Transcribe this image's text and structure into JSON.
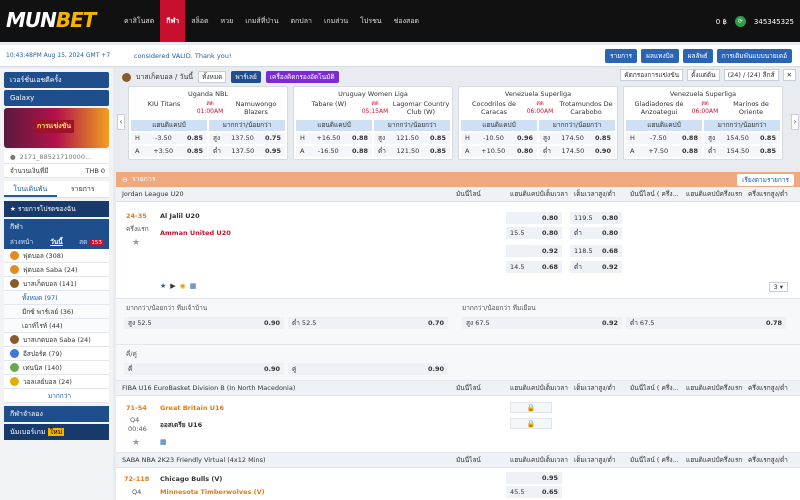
{
  "brand": {
    "logo_a": "MUN",
    "logo_b": "BET"
  },
  "nav": [
    "คาสิโนสด",
    "กีฬา",
    "สล็อต",
    "หวย",
    "เกมส์ที่ป่าน",
    "ตกปลา",
    "เกมส่วน",
    "โปรชน",
    "ช่องสอด"
  ],
  "nav_active": 1,
  "account": {
    "balance": "0 ฿",
    "user": "345345325"
  },
  "ticker": {
    "time": "10:43:48PM Aug 15, 2024 GMT +7",
    "message": "considered VALID. Thank you!",
    "buttons": [
      "รายการ",
      "ผลแทงบิล",
      "ผลลัพธ์",
      "การเดิมพันแบบนายเดอ์"
    ]
  },
  "sidebar": {
    "banner1": "เวอร์ชั่นเอชดีครั้ง",
    "banner2": "Galaxy",
    "promo": "การแข่งขัน",
    "account_id": "2171_88521710000...",
    "balance_label": "จำนวนเงินที่มี",
    "balance": "THB 0",
    "tabs": [
      "โบนเดินพัน",
      "รายการ"
    ],
    "favorites": "รายการโปรดของฉัน",
    "sport_header": "กีฬา",
    "subtabs": [
      "ล่วงหน้า",
      "วันนี้",
      "สด"
    ],
    "live_count": "153",
    "items": [
      {
        "label": "ฟุตบอล (308)",
        "icon": "football-icon"
      },
      {
        "label": "ฟุตบอล Saba (24)",
        "icon": "football-icon"
      },
      {
        "label": "บาสเก็ตบอล (141)",
        "icon": "basketball-icon"
      }
    ],
    "subitems": [
      "ทั้งหมด (97)",
      "มีกซ์ พาร์เลย์ (36)",
      "เอาท์ไรท์ (44)"
    ],
    "items2": [
      {
        "label": "บาสเกตบอล Saba (24)",
        "icon": "basketball-icon"
      },
      {
        "label": "อีสปอร์ต (79)",
        "icon": "esport-icon"
      },
      {
        "label": "เทนนิส (140)",
        "icon": "tennis-icon"
      },
      {
        "label": "วอลเลย์บอล (24)",
        "icon": "volleyball-icon"
      }
    ],
    "more": "มากกว่า",
    "virtual": "กีฬาจำลอง",
    "number": "นัมเบอร์เกม",
    "new_badge": "ใหม่"
  },
  "main": {
    "title": "บาสเก็ตบอล / วันนี้",
    "filter": "ทั้งหมด",
    "parlay": "พาร์เลย์",
    "combo": "เครื่องคิดกรองอัตโนมัติ",
    "sort": "คัดกรองการแข่งขัน",
    "view": "ตั้งแต่ต้น",
    "count": "(24) / (24) ลีกส์"
  },
  "cards": [
    {
      "league": "Uganda NBL",
      "home": "KIU Titans",
      "away": "Namuwongo Blazers",
      "live": "สด",
      "time": "01:00AM",
      "h_hcp": "-3.50",
      "h_odds": "0.85",
      "a_hcp": "+3.50",
      "a_odds": "0.85",
      "ou_o": "137.50",
      "ou_o_odds": "0.75",
      "ou_u": "137.50",
      "ou_u_odds": "0.95"
    },
    {
      "league": "Uruguay Women Liga",
      "home": "Tabare (W)",
      "away": "Lagomar Country Club (W)",
      "live": "สด",
      "time": "05:15AM",
      "h_hcp": "+16.50",
      "h_odds": "0.88",
      "a_hcp": "-16.50",
      "a_odds": "0.88",
      "ou_o": "121.50",
      "ou_o_odds": "0.85",
      "ou_u": "121.50",
      "ou_u_odds": "0.85"
    },
    {
      "league": "Venezuela Superliga",
      "home": "Cocodrilos de Caracas",
      "away": "Trotamundos De Carabobo",
      "live": "สด",
      "time": "06:00AM",
      "h_hcp": "-10.50",
      "h_odds": "0.96",
      "a_hcp": "+10.50",
      "a_odds": "0.80",
      "ou_o": "174.50",
      "ou_o_odds": "0.85",
      "ou_u": "174.50",
      "ou_u_odds": "0.90"
    },
    {
      "league": "Venezuela Superliga",
      "home": "Gladiadores de Anzoategui",
      "away": "Marinos de Oriente",
      "live": "สด",
      "time": "06:00AM",
      "h_hcp": "-7.50",
      "h_odds": "0.88",
      "a_hcp": "+7.50",
      "a_odds": "0.88",
      "ou_o": "154.50",
      "ou_o_odds": "0.85",
      "ou_u": "154.50",
      "ou_u_odds": "0.85"
    }
  ],
  "card_labels": {
    "hcp": "แฮนดิแคปป์",
    "ou": "มากกว่า/น้อยกว่า",
    "over": "สูง",
    "under": "ต่ำ",
    "h": "H",
    "a": "A"
  },
  "board": {
    "header": "รายการ",
    "sort_btn": "เรียงตามรายการ",
    "col_headers": [
      "มันนี่ไลน์",
      "แฮนดิแคปป์เต็มเวลา",
      "เต็มเวลาสูง/ต่ำ",
      "มันนี่ไลน์ ( ครึ่ง...",
      "แฮนดิแคปป์ครึ่งแรก",
      "ครึ่งแรกสูง/ต่ำ"
    ],
    "league1": "Jordan League U20",
    "score1": "24-35",
    "period1": "ครึ่งแรก",
    "team1a": "Al Jalil U20",
    "team1b": "Amman United U20",
    "r1": {
      "hcp_o": "0.80",
      "ou_line": "119.5",
      "ou_o": "0.80",
      "hcp_line": "15.5",
      "hcp_b": "0.80",
      "under": "ต่ำ",
      "ou_u": "0.80"
    },
    "r2": {
      "hcp_o": "0.92",
      "ou_line": "118.5",
      "ou_o": "0.68",
      "hcp_line": "14.5",
      "hcp_b": "0.68",
      "under": "ต่ำ",
      "ou_u": "0.92"
    },
    "pager": "3",
    "ou_home": "มากกว่า/น้อยกว่า ทีมเจ้าบ้าน",
    "ou_away": "มากกว่า/น้อยกว่า ทีมเยือน",
    "ou_home_rows": [
      {
        "l": "สูง 52.5",
        "v": "0.90"
      },
      {
        "l": "ต่ำ 52.5",
        "v": "0.70"
      }
    ],
    "ou_away_rows": [
      {
        "l": "สูง 67.5",
        "v": "0.92"
      },
      {
        "l": "ต่ำ 67.5",
        "v": "0.78"
      }
    ],
    "oddeven": "คี่/คู่",
    "odd": "คี่",
    "odd_v": "0.90",
    "even": "คู่",
    "even_v": "0.90",
    "league2": "FIBA U16 EuroBasket Division B (In North Macedonia)",
    "score2": "71-54",
    "period2": "Q4",
    "clock2": "00:46",
    "team2a": "Great Britain U16",
    "team2b": "ออสเตรีย U16",
    "league3": "SABA NBA 2K23 Friendly Virtual (4x12 Mins)",
    "score3": "72-118",
    "period3": "Q4",
    "team3a": "Chicago Bulls (V)",
    "team3b": "Minnesota Timberwolves (V)",
    "r3a": "0.95",
    "r3_line": "45.5",
    "r3b": "0.65"
  }
}
